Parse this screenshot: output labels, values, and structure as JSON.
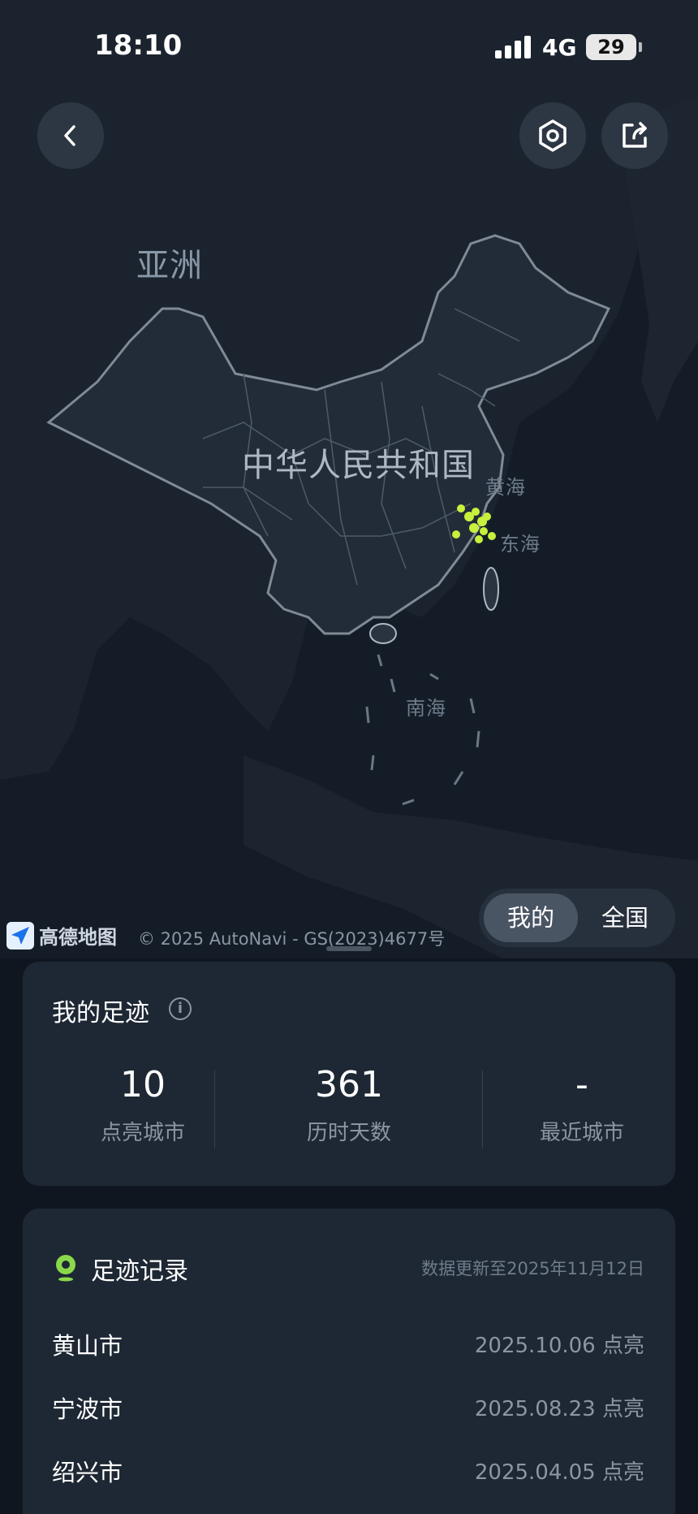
{
  "status_bar": {
    "time": "18:10",
    "network": "4G",
    "battery": "29"
  },
  "map": {
    "continent_label": "亚洲",
    "country_label": "中华人民共和国",
    "sea_labels": [
      "黄海",
      "东海",
      "南海"
    ],
    "provider_logo": "高德地图",
    "copyright": "© 2025 AutoNavi - GS(2023)4677号",
    "highlight_color": "#c8f03c"
  },
  "top_buttons": {
    "back_icon": "chevron-left-icon",
    "settings_icon": "hexagon-settings-icon",
    "share_icon": "share-icon"
  },
  "toggle": {
    "options": [
      "我的",
      "全国"
    ],
    "selected": "我的"
  },
  "footprint": {
    "title": "我的足迹",
    "stats": [
      {
        "value": "10",
        "label": "点亮城市"
      },
      {
        "value": "361",
        "label": "历时天数"
      },
      {
        "value": "-",
        "label": "最近城市"
      }
    ]
  },
  "records": {
    "title": "足迹记录",
    "update_text": "数据更新至2025年11月12日",
    "items": [
      {
        "city": "黄山市",
        "date": "2025.10.06 点亮"
      },
      {
        "city": "宁波市",
        "date": "2025.08.23 点亮"
      },
      {
        "city": "绍兴市",
        "date": "2025.04.05 点亮"
      }
    ]
  }
}
